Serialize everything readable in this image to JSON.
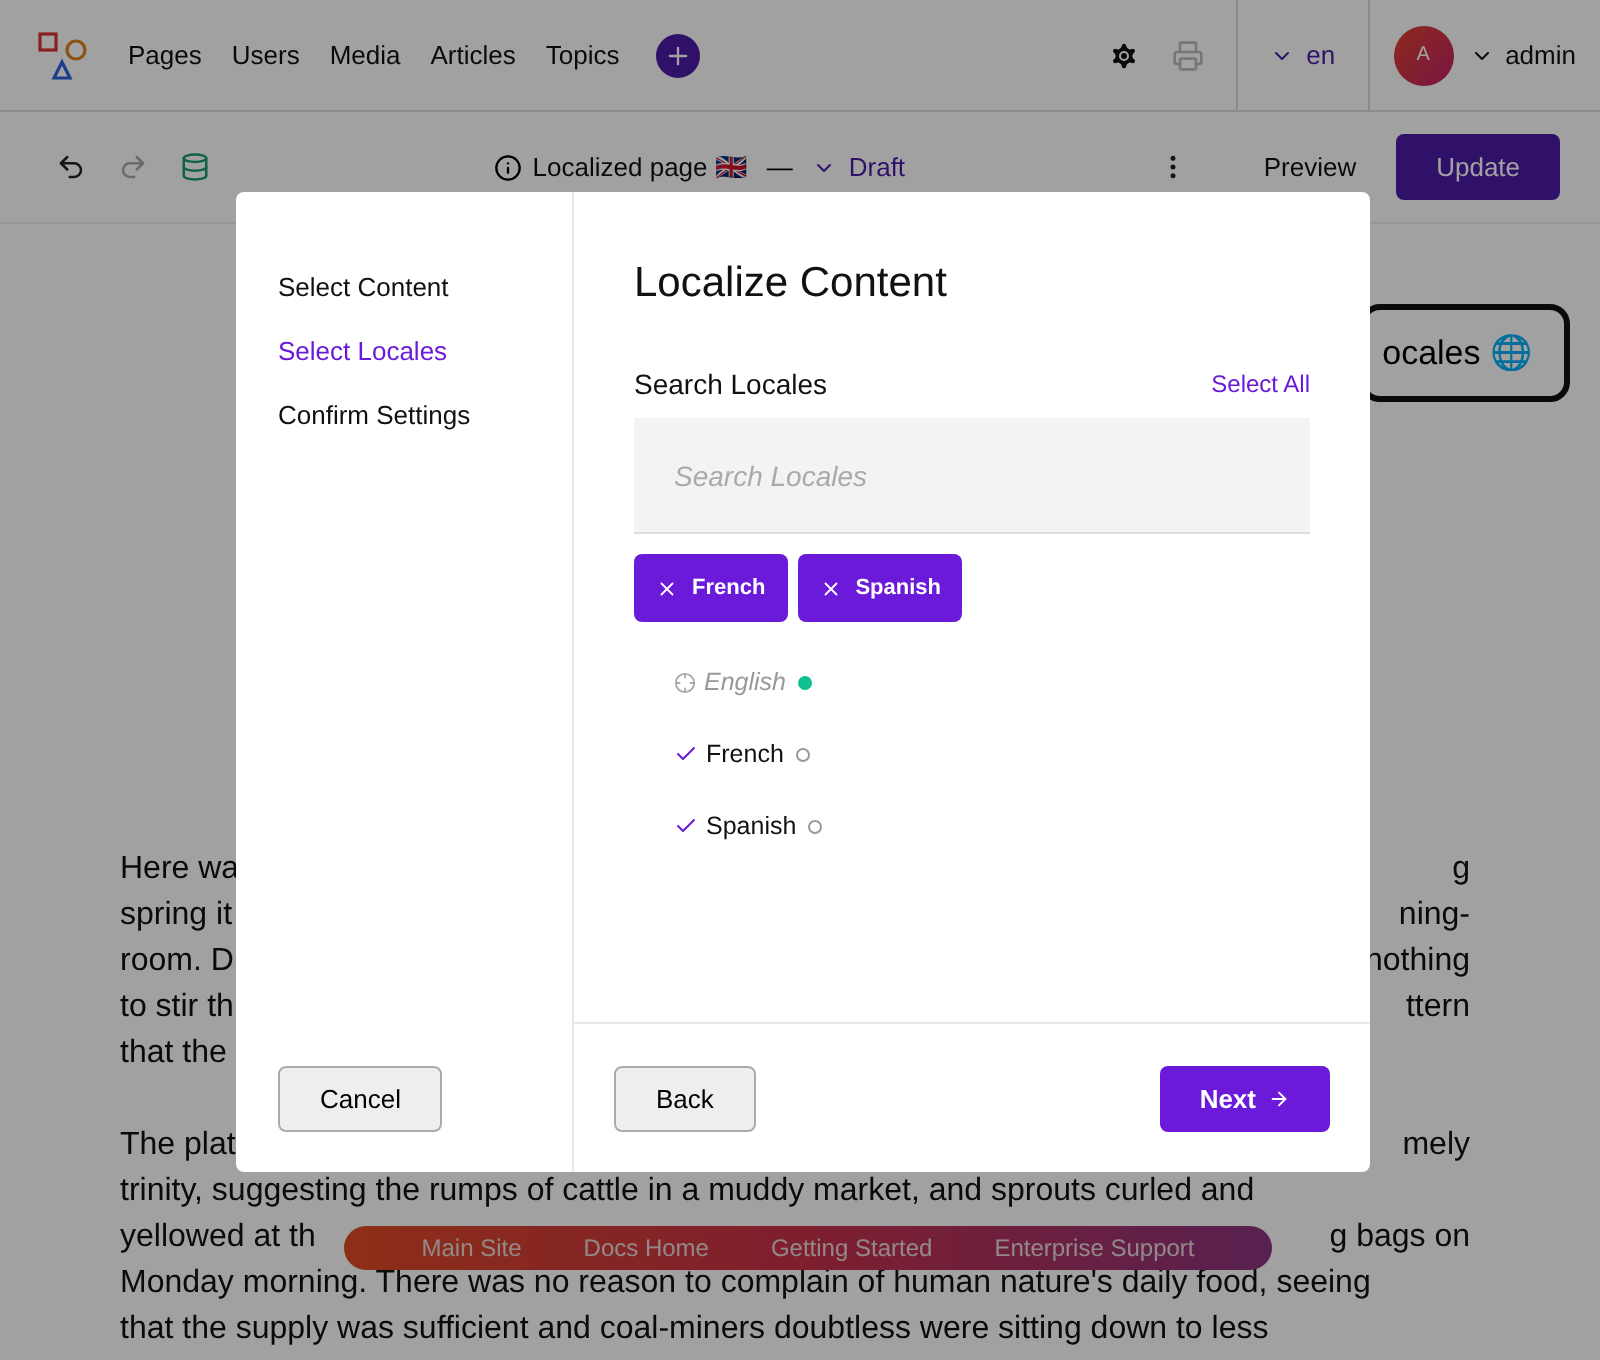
{
  "header": {
    "nav": [
      "Pages",
      "Users",
      "Media",
      "Articles",
      "Topics"
    ],
    "language": "en",
    "avatar_initial": "A",
    "user": "admin"
  },
  "toolbar": {
    "page_label": "Localized page 🇬🇧",
    "separator": "—",
    "status": "Draft",
    "preview": "Preview",
    "update": "Update"
  },
  "background": {
    "locales_button": "ocales 🌐",
    "paragraphs": [
      [
        [
          "Here wa",
          "g"
        ],
        [
          "spring it",
          "ning-"
        ],
        [
          "room. D",
          "nothing"
        ],
        [
          "to stir th",
          "ttern"
        ],
        [
          "that the"
        ]
      ],
      [
        [
          "The plat",
          "mely"
        ],
        [
          "trinity, suggesting the rumps of cattle in a muddy market, and sprouts curled and"
        ],
        [
          "yellowed at th",
          "g bags on"
        ],
        [
          "Monday morning. There was no reason to complain of human nature's daily food, seeing"
        ],
        [
          "that the supply was sufficient and coal-miners doubtless were sitting down to less"
        ]
      ]
    ]
  },
  "footer_nav": [
    "Main Site",
    "Docs Home",
    "Getting Started",
    "Enterprise Support"
  ],
  "modal": {
    "steps": [
      {
        "label": "Select Content",
        "selected": false
      },
      {
        "label": "Select Locales",
        "selected": true
      },
      {
        "label": "Confirm Settings",
        "selected": false
      }
    ],
    "title": "Localize Content",
    "search_label": "Search Locales",
    "select_all": "Select All",
    "search_placeholder": "Search Locales",
    "chips": [
      "French",
      "Spanish"
    ],
    "locales": [
      {
        "name": "English",
        "kind": "source",
        "checked": false,
        "published": true
      },
      {
        "name": "French",
        "kind": "target",
        "checked": true,
        "published": false
      },
      {
        "name": "Spanish",
        "kind": "target",
        "checked": true,
        "published": false
      }
    ],
    "cancel": "Cancel",
    "back": "Back",
    "next": "Next"
  }
}
